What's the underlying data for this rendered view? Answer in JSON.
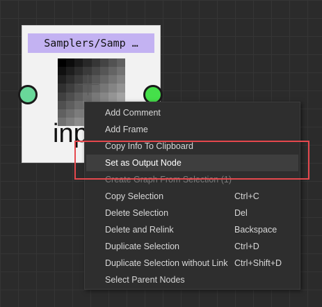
{
  "node": {
    "title": "Samplers/Samp …",
    "label": "inp",
    "preview_shades": [
      [
        "#000000",
        "#0c0c0c",
        "#1a1a1a",
        "#282828",
        "#363636",
        "#444444",
        "#525252",
        "#606060"
      ],
      [
        "#101010",
        "#1e1e1e",
        "#2c2c2c",
        "#3a3a3a",
        "#484848",
        "#565656",
        "#646464",
        "#727272"
      ],
      [
        "#202020",
        "#2e2e2e",
        "#3c3c3c",
        "#4a4a4a",
        "#585858",
        "#666666",
        "#747474",
        "#828282"
      ],
      [
        "#303030",
        "#3e3e3e",
        "#4c4c4c",
        "#5a5a5a",
        "#686868",
        "#767676",
        "#848484",
        "#929292"
      ],
      [
        "#404040",
        "#4e4e4e",
        "#5c5c5c",
        "#6a6a6a",
        "#787878",
        "#868686",
        "#949494",
        "#a2a2a2"
      ],
      [
        "#505050",
        "#5e5e5e",
        "#6c6c6c",
        "#7a7a7a",
        "#888888",
        "#969696",
        "#a4a4a4",
        "#b2b2b2"
      ],
      [
        "#606060",
        "#6e6e6e",
        "#7c7c7c",
        "#8a8a8a",
        "#989898",
        "#a6a6a6",
        "#b4b4b4",
        "#c2c2c2"
      ],
      [
        "#707070",
        "#7e7e7e",
        "#8c8c8c",
        "#9a9a9a",
        "#a8a8a8",
        "#b6b6b6",
        "#c4c4c4",
        "#d2d2d2"
      ]
    ],
    "input_port_color": "#69d89a",
    "output_port_color": "#45e04a"
  },
  "context_menu": {
    "items": [
      {
        "label": "Add Comment",
        "shortcut": "",
        "state": "normal"
      },
      {
        "label": "Add Frame",
        "shortcut": "",
        "state": "normal"
      },
      {
        "label": "Copy Info To Clipboard",
        "shortcut": "",
        "state": "normal"
      },
      {
        "label": "Set as Output Node",
        "shortcut": "",
        "state": "highlighted"
      },
      {
        "label": "Create Graph From Selection (1)",
        "shortcut": "",
        "state": "disabled"
      },
      {
        "label": "Copy Selection",
        "shortcut": "Ctrl+C",
        "state": "normal"
      },
      {
        "label": "Delete Selection",
        "shortcut": "Del",
        "state": "normal"
      },
      {
        "label": "Delete and Relink",
        "shortcut": "Backspace",
        "state": "normal"
      },
      {
        "label": "Duplicate Selection",
        "shortcut": "Ctrl+D",
        "state": "normal"
      },
      {
        "label": "Duplicate Selection without Link",
        "shortcut": "Ctrl+Shift+D",
        "state": "normal"
      },
      {
        "label": "Select Parent Nodes",
        "shortcut": "",
        "state": "normal"
      }
    ]
  },
  "annotation": {
    "color": "#e5484d"
  }
}
